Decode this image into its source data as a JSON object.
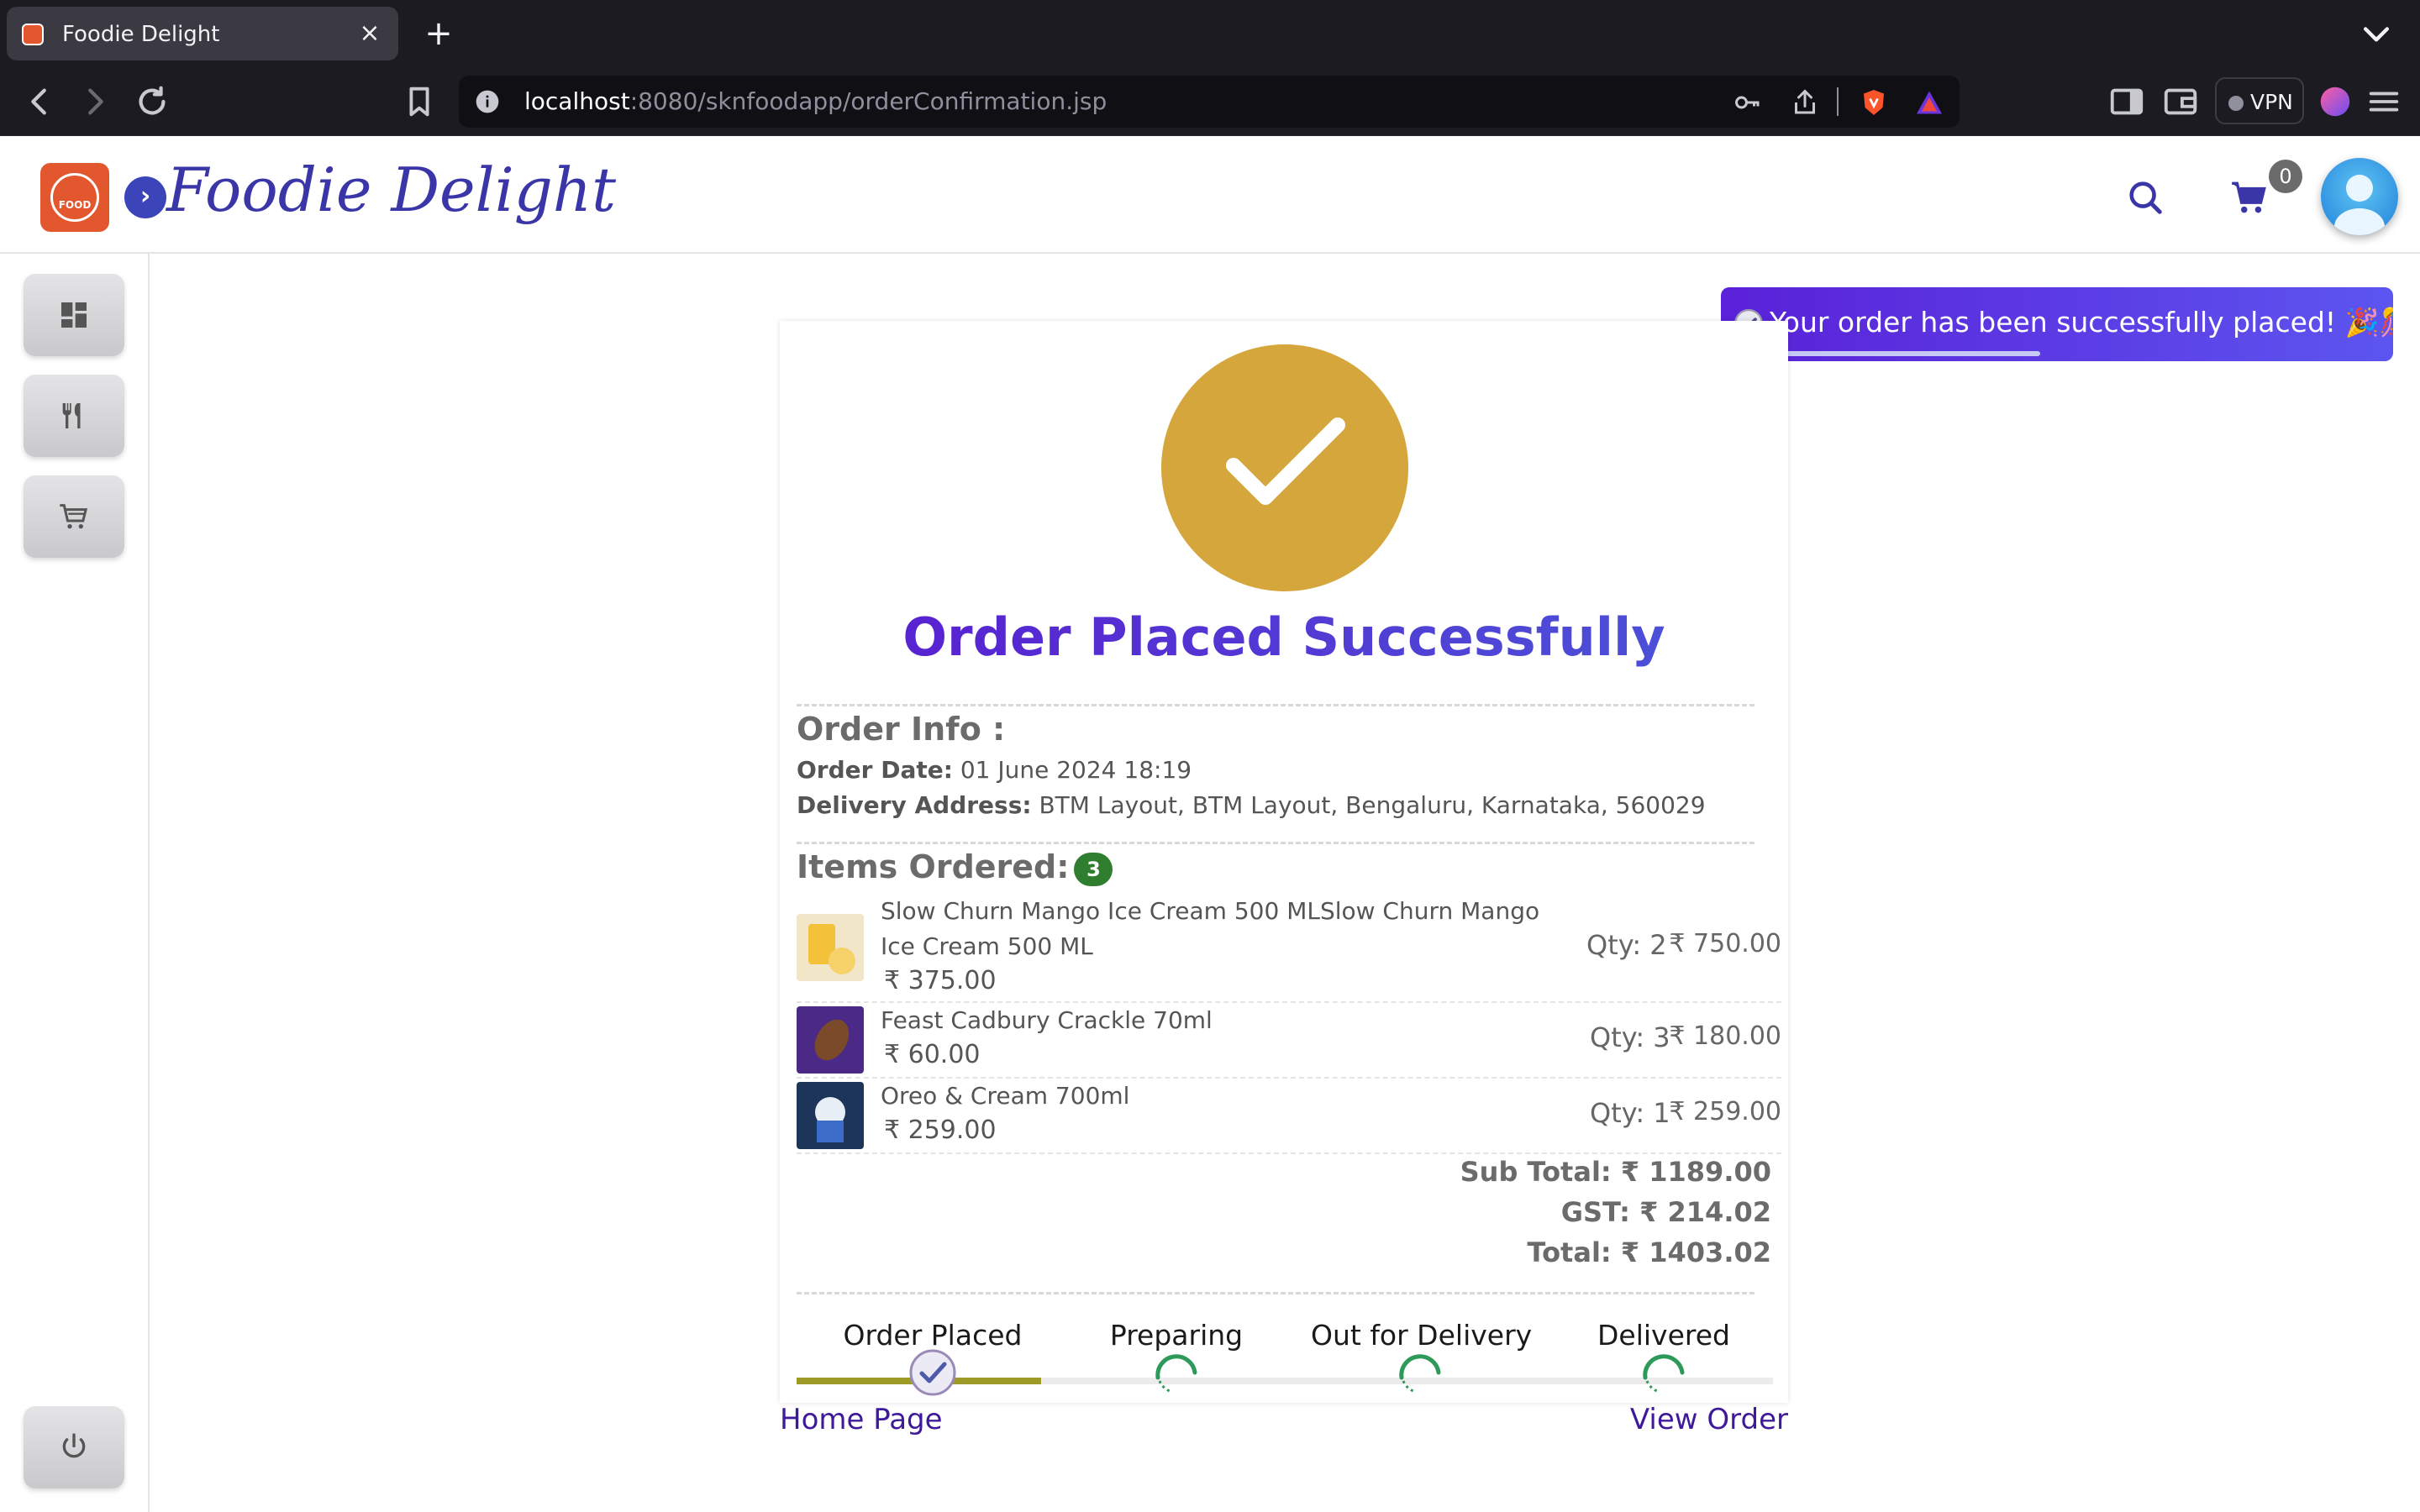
{
  "browser": {
    "tab_title": "Foodie Delight",
    "url_host": "localhost",
    "url_path": ":8080/sknfoodapp/orderConfirmation.jsp",
    "vpn_label": "VPN"
  },
  "header": {
    "logo_text": "FOOD",
    "brand": "Foodie Delight",
    "cart_count": "0"
  },
  "toast": {
    "message": "Your order has been successfully placed! 🎉🎊"
  },
  "confirmation": {
    "title": "Order Placed Successfully",
    "order_info_heading": "Order Info :",
    "order_date_label": "Order Date:",
    "order_date": "01 June 2024 18:19",
    "address_label": "Delivery Address:",
    "address": "BTM Layout, BTM Layout, Bengaluru, Karnataka, 560029",
    "items_heading": "Items Ordered:",
    "items_count": "3",
    "items": [
      {
        "name": "Slow Churn Mango Ice Cream 500 MLSlow Churn Mango Ice Cream 500 ML",
        "price": "₹ 375.00",
        "qty": "Qty: 2",
        "total": "₹ 750.00"
      },
      {
        "name": "Feast Cadbury Crackle 70ml",
        "price": "₹ 60.00",
        "qty": "Qty: 3",
        "total": "₹ 180.00"
      },
      {
        "name": "Oreo & Cream 700ml",
        "price": "₹ 259.00",
        "qty": "Qty: 1",
        "total": "₹ 259.00"
      }
    ],
    "subtotal_label": "Sub Total:",
    "subtotal": "₹ 1189.00",
    "gst_label": "GST:",
    "gst": "₹ 214.02",
    "total_label": "Total:",
    "total": "₹ 1403.02",
    "steps": [
      "Order Placed",
      "Preparing",
      "Out for Delivery",
      "Delivered"
    ],
    "progress_fraction": 0.25,
    "home_link": "Home Page",
    "view_order_link": "View Order"
  },
  "colors": {
    "accent": "#3a36a8",
    "check_circle": "#d4a63c",
    "progress": "#9e9a28",
    "spinner": "#2e9a5a",
    "badge": "#2f7d2f"
  },
  "icons": [
    "back-icon",
    "forward-icon",
    "reload-icon",
    "bookmark-icon",
    "info-icon",
    "key-icon",
    "share-icon",
    "brave-shield-icon",
    "brave-rewards-icon",
    "sidebar-icon",
    "wallet-icon",
    "search-icon",
    "cart-icon",
    "dashboard-icon",
    "utensils-icon",
    "cart-icon",
    "power-icon",
    "check-icon",
    "spinner-icon"
  ]
}
